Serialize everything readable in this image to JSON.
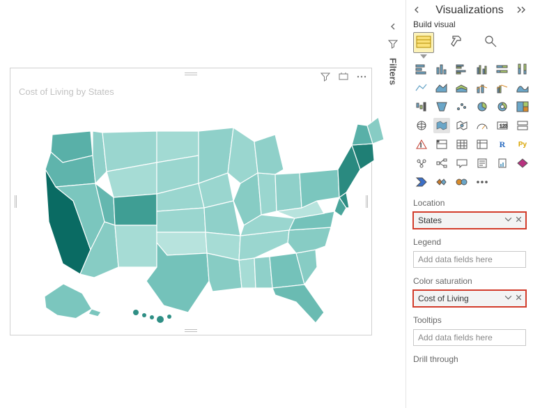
{
  "canvas": {
    "viz_title": "Cost of Living by States",
    "filters_tab_label": "Filters"
  },
  "panel": {
    "title": "Visualizations",
    "build_label": "Build visual",
    "mode_tabs": {
      "build": "build",
      "format": "format",
      "analytics": "analytics"
    },
    "fields": {
      "location": {
        "label": "Location",
        "value": "States"
      },
      "legend": {
        "label": "Legend",
        "placeholder": "Add data fields here"
      },
      "color_sat": {
        "label": "Color saturation",
        "value": "Cost of Living"
      },
      "tooltips": {
        "label": "Tooltips",
        "placeholder": "Add data fields here"
      },
      "drill": {
        "label": "Drill through"
      }
    }
  }
}
